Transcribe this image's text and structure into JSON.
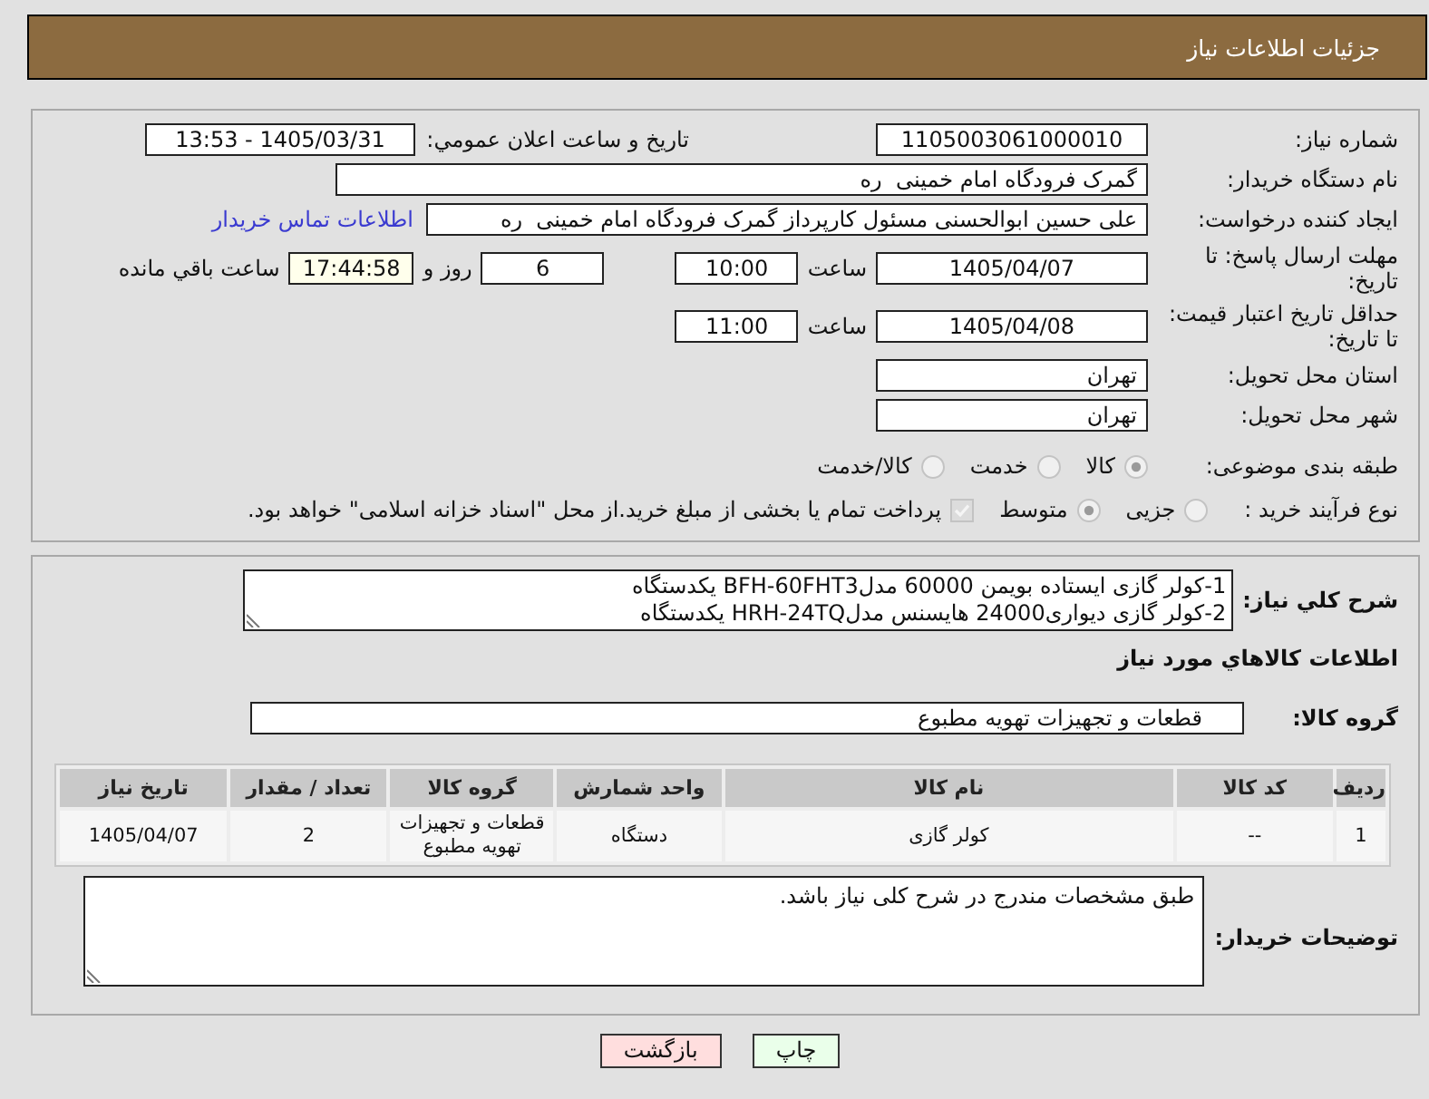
{
  "header": {
    "title": "جزئیات اطلاعات نیاز"
  },
  "details": {
    "need_number": {
      "label": "شماره نیاز:",
      "value": "1105003061000010"
    },
    "announce_datetime": {
      "label": "تاریخ و ساعت اعلان عمومي:",
      "value": "1405/03/31 - 13:53"
    },
    "buyer_org": {
      "label": "نام دستگاه خریدار:",
      "value": "گمرک فرودگاه امام خمینی  ره"
    },
    "requester": {
      "label": "ایجاد کننده درخواست:",
      "value": "علی حسین ابوالحسنی مسئول کارپرداز گمرک فرودگاه امام خمینی  ره",
      "link": "اطلاعات تماس خریدار"
    },
    "reply_deadline": {
      "label": "مهلت ارسال پاسخ: تا تاریخ:",
      "date": "1405/04/07",
      "time_label": "ساعت",
      "time": "10:00",
      "days": "6",
      "days_label": "روز و",
      "remaining": "17:44:58",
      "remaining_label": "ساعت باقي مانده"
    },
    "price_validity": {
      "label": "حداقل تاریخ اعتبار قیمت: تا تاریخ:",
      "date": "1405/04/08",
      "time_label": "ساعت",
      "time": "11:00"
    },
    "delivery_province": {
      "label": "استان محل تحویل:",
      "value": "تهران"
    },
    "delivery_city": {
      "label": "شهر محل تحویل:",
      "value": "تهران"
    },
    "category": {
      "label": "طبقه بندی موضوعی:",
      "disabled": true,
      "options": [
        {
          "label": "کالا",
          "selected": true
        },
        {
          "label": "خدمت",
          "selected": false
        },
        {
          "label": "کالا/خدمت",
          "selected": false
        }
      ]
    },
    "purchase_type": {
      "label": "نوع فرآیند خرید :",
      "disabled": true,
      "options": [
        {
          "label": "جزیی",
          "selected": false
        },
        {
          "label": "متوسط",
          "selected": true
        }
      ],
      "treasury_payment": {
        "label": "پرداخت تمام یا بخشی از مبلغ خرید.از محل \"اسناد خزانه اسلامی\" خواهد بود.",
        "checked": true,
        "disabled": true
      }
    }
  },
  "needs": {
    "description": {
      "label": "شرح کلي نیاز:",
      "lines": [
        "1-کولر گازی ایستاده بویمن 60000 مدلBFH-60FHT3 یکدستگاه",
        "2-کولر گازی دیواری24000 هایسنس مدلHRH-24TQ یکدستگاه"
      ]
    },
    "goods_heading": "اطلاعات کالاهاي مورد نیاز",
    "goods_group": {
      "label": "گروه کالا:",
      "value": "قطعات و تجهیزات تهویه مطبوع"
    },
    "table": {
      "columns": [
        "ردیف",
        "کد کالا",
        "نام کالا",
        "واحد شمارش",
        "گروه کالا",
        "تعداد / مقدار",
        "تاریخ نیاز"
      ],
      "rows": [
        [
          "1",
          "--",
          "کولر گازی",
          "دستگاه",
          "قطعات و تجهیزات تهویه مطبوع",
          "2",
          "1405/04/07"
        ]
      ]
    },
    "buyer_notes": {
      "label": "توضیحات خریدار:",
      "value": "طبق مشخصات مندرج در شرح کلی نیاز باشد."
    }
  },
  "buttons": [
    {
      "label": "چاپ",
      "kind": "print"
    },
    {
      "label": "بازگشت",
      "kind": "back"
    }
  ]
}
